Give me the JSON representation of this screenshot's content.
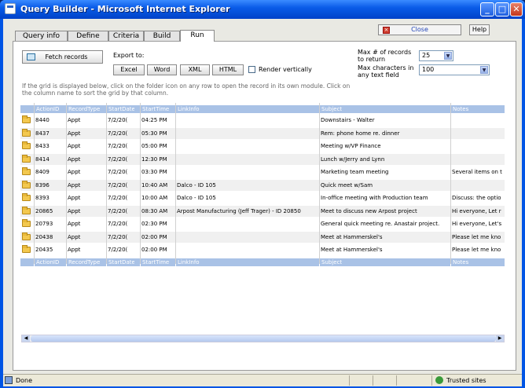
{
  "window": {
    "title": "Query Builder - Microsoft Internet Explorer"
  },
  "tabs": [
    "Query info",
    "Define",
    "Criteria",
    "Build",
    "Run"
  ],
  "toolbar": {
    "close_label": "Close",
    "help_label": "Help",
    "fetch_label": "Fetch records",
    "export_label": "Export to:",
    "excel": "Excel",
    "word": "Word",
    "xml": "XML",
    "html": "HTML",
    "render_vertically": "Render vertically"
  },
  "options": {
    "max_records_label": "Max # of records to return",
    "max_records_value": "25",
    "max_chars_label": "Max characters in any text field",
    "max_chars_value": "100"
  },
  "help_text": "If the grid is displayed below, click on the folder icon on any row to open the record in its own module. Click on the column name to sort the grid by that column.",
  "grid": {
    "columns": [
      "ActionID",
      "RecordType",
      "StartDate",
      "StartTime",
      "LinkInfo",
      "Subject",
      "Notes"
    ],
    "rows": [
      [
        "8440",
        "Appt",
        "7/2/20(",
        "04:25 PM",
        "",
        "Downstairs - Walter",
        ""
      ],
      [
        "8437",
        "Appt",
        "7/2/20(",
        "05:30 PM",
        "",
        "Rem: phone home re. dinner",
        ""
      ],
      [
        "8433",
        "Appt",
        "7/2/20(",
        "05:00 PM",
        "",
        "Meeting w/VP Finance",
        ""
      ],
      [
        "8414",
        "Appt",
        "7/2/20(",
        "12:30 PM",
        "",
        "Lunch w/Jerry and Lynn",
        ""
      ],
      [
        "8409",
        "Appt",
        "7/2/20(",
        "03:30 PM",
        "",
        "Marketing team meeting",
        "Several items on t"
      ],
      [
        "8396",
        "Appt",
        "7/2/20(",
        "10:40 AM",
        "Dalco - ID 105",
        "Quick meet w/Sam",
        ""
      ],
      [
        "8393",
        "Appt",
        "7/2/20(",
        "10:00 AM",
        "Dalco - ID 105",
        "In-office meeting with Production team",
        "Discuss: the optio"
      ],
      [
        "20865",
        "Appt",
        "7/2/20(",
        "08:30 AM",
        "Arpost Manufacturing (Jeff Trager) - ID 20850",
        "Meet to discuss new Arpost project",
        "Hi everyone, Let r"
      ],
      [
        "20793",
        "Appt",
        "7/2/20(",
        "02:30 PM",
        "",
        "General quick meeting re. Anastair project.",
        "Hi everyone, Let's"
      ],
      [
        "20438",
        "Appt",
        "7/2/20(",
        "02:00 PM",
        "",
        "Meet at Hammerskel's",
        "Please let me kno"
      ],
      [
        "20435",
        "Appt",
        "7/2/20(",
        "02:00 PM",
        "",
        "Meet at Hammerskel's",
        "Please let me kno"
      ]
    ]
  },
  "statusbar": {
    "left": "Done",
    "zone": "Trusted sites"
  }
}
